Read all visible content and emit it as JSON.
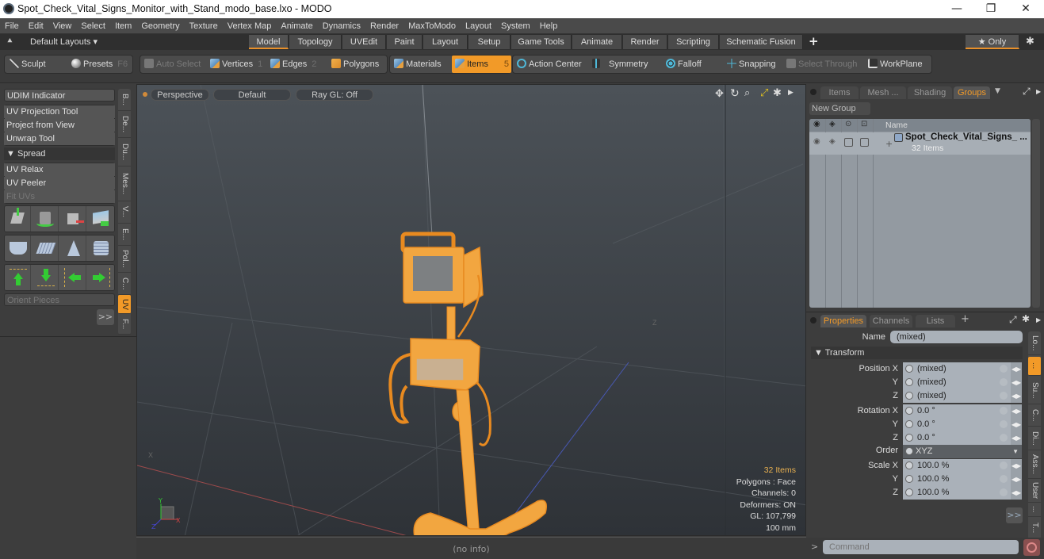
{
  "window": {
    "title": "Spot_Check_Vital_Signs_Monitor_with_Stand_modo_base.lxo - MODO",
    "controls": {
      "minimize": "—",
      "maximize": "❐",
      "close": "✕"
    }
  },
  "menubar": [
    "File",
    "Edit",
    "View",
    "Select",
    "Item",
    "Geometry",
    "Texture",
    "Vertex Map",
    "Animate",
    "Dynamics",
    "Render",
    "MaxToModo",
    "Layout",
    "System",
    "Help"
  ],
  "layoutbar": {
    "default_layouts": "Default Layouts ▾",
    "tabs": [
      "Model",
      "Topology",
      "UVEdit",
      "Paint",
      "Layout",
      "Setup",
      "Game Tools",
      "Animate",
      "Render",
      "Scripting",
      "Schematic Fusion"
    ],
    "active_tab": "Model",
    "add": "+",
    "only": "★  Only",
    "gear": "✱"
  },
  "toolbar": {
    "sculpt": "Sculpt",
    "presets": "Presets",
    "presets_key": "F6",
    "auto_select": "Auto Select",
    "vertices": "Vertices",
    "vertices_num": "1",
    "edges": "Edges",
    "edges_num": "2",
    "polygons": "Polygons",
    "materials": "Materials",
    "items": "Items",
    "items_num": "5",
    "action_center": "Action Center",
    "symmetry": "Symmetry",
    "falloff": "Falloff",
    "snapping": "Snapping",
    "select_through": "Select Through",
    "workplane": "WorkPlane"
  },
  "leftpanel": {
    "udim": "UDIM Indicator",
    "uv_projection": "UV Projection Tool",
    "project_from_view": "Project from View",
    "unwrap": "Unwrap Tool",
    "spread": "▼ Spread",
    "uv_relax": "UV Relax",
    "uv_peeler": "UV Peeler",
    "fit_uvs": "Fit UVs",
    "orient_pieces": "Orient Pieces",
    "more": ">>",
    "vtabs": [
      "B...",
      "De...",
      "Du...",
      "Mes...",
      "V...",
      "E...",
      "Pol...",
      "C...",
      "UV",
      "F..."
    ],
    "active_vtab": "UV"
  },
  "viewport": {
    "view": "Perspective",
    "shading": "Default",
    "raygl": "Ray GL: Off",
    "info": {
      "items": "32 Items",
      "polygons": "Polygons : Face",
      "channels": "Channels: 0",
      "deformers": "Deformers: ON",
      "gl": "GL: 107,799",
      "scale": "100 mm"
    },
    "status": "(no info)",
    "accent": "#f29a28"
  },
  "groups_panel": {
    "tabs": [
      "Items",
      "Mesh ...",
      "Shading",
      "Groups"
    ],
    "active_tab": "Groups",
    "new_group": "New Group",
    "col_name": "Name",
    "row": {
      "name": "Spot_Check_Vital_Signs_ ...",
      "count": "32 Items"
    }
  },
  "properties_panel": {
    "tabs": [
      "Properties",
      "Channels",
      "Lists"
    ],
    "active_tab": "Properties",
    "name_label": "Name",
    "name_value": "(mixed)",
    "transform": "▼ Transform",
    "position": {
      "label": "Position X",
      "x": "(mixed)",
      "y": "(mixed)",
      "z": "(mixed)"
    },
    "rotation": {
      "label": "Rotation X",
      "x": "0.0 °",
      "y": "0.0 °",
      "z": "0.0 °"
    },
    "order": {
      "label": "Order",
      "value": "XYZ"
    },
    "scale": {
      "label": "Scale X",
      "x": "100.0 %",
      "y": "100.0 %",
      "z": "100.0 %"
    },
    "axis_y": "Y",
    "axis_z": "Z",
    "more": ">>",
    "vtabs": [
      "Lo...",
      "...",
      "Su...",
      "C...",
      "Di...",
      "Ass...",
      "User",
      "...",
      "T..."
    ],
    "active_vtab": "..."
  },
  "command": {
    "prompt": ">",
    "placeholder": "Command"
  }
}
